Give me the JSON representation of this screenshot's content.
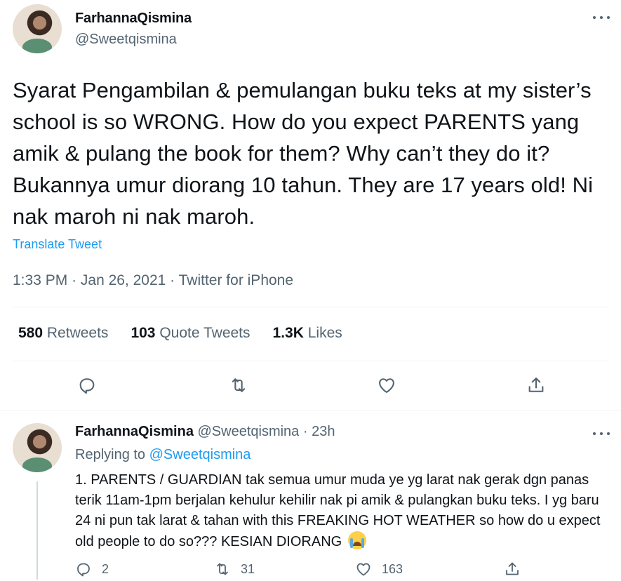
{
  "main_tweet": {
    "author_name": "FarhannaQismina",
    "author_handle": "@Sweetqismina",
    "text": "Syarat Pengambilan & pemulangan buku teks at my sister’s school is so WRONG. How do you expect PARENTS yang amik & pulang the book for them? Why can’t they do it? Bukannya umur diorang 10 tahun. They are 17 years old! Ni nak maroh ni nak maroh.",
    "translate_label": "Translate Tweet",
    "time": "1:33 PM",
    "date": "Jan 26, 2021",
    "source": "Twitter for iPhone",
    "stats": [
      {
        "count": "580",
        "label": "Retweets"
      },
      {
        "count": "103",
        "label": "Quote Tweets"
      },
      {
        "count": "1.3K",
        "label": "Likes"
      }
    ],
    "actions": [
      "reply-icon",
      "retweet-icon",
      "like-icon",
      "share-icon"
    ]
  },
  "reply_tweet": {
    "author_name": "FarhannaQismina",
    "author_handle": "@Sweetqismina",
    "time": "23h",
    "replying_prefix": "Replying to",
    "replying_to": "@Sweetqismina",
    "text": "1. PARENTS / GUARDIAN tak semua umur muda ye yg larat nak gerak dgn panas terik 11am-1pm berjalan kehulur kehilir nak pi amik & pulangkan buku teks. I yg baru 24 ni pun tak larat & tahan with this FREAKING HOT WEATHER so how do u expect old people to do so??? KESIAN DIORANG",
    "emoji_icon": "loudly-crying-face-emoji",
    "reply_count": "2",
    "retweet_count": "31",
    "like_count": "163"
  },
  "colors": {
    "text": "#0f1419",
    "secondary": "#536471",
    "link": "#1d9bf0",
    "border": "#eff3f4"
  }
}
